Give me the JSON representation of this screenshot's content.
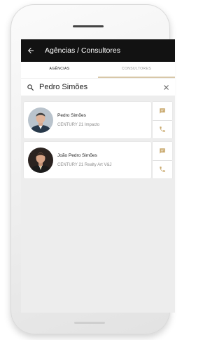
{
  "appbar": {
    "title": "Agências / Consultores",
    "back_icon": "arrow-left-icon"
  },
  "tabs": [
    {
      "label": "AGÊNCIAS",
      "active": true
    },
    {
      "label": "CONSULTORES",
      "active": false
    }
  ],
  "search": {
    "value": "Pedro Simões",
    "icon": "search-icon",
    "clear_icon": "close-icon"
  },
  "results": [
    {
      "name": "Pedro Simões",
      "agency": "CENTURY 21 Impacto"
    },
    {
      "name": "João Pedro Simões",
      "agency": "CENTURY 21 Realty Art V&J"
    }
  ],
  "colors": {
    "accent": "#c9a96e",
    "appbar": "#121212",
    "tab_underline": "#d8c7a8"
  }
}
